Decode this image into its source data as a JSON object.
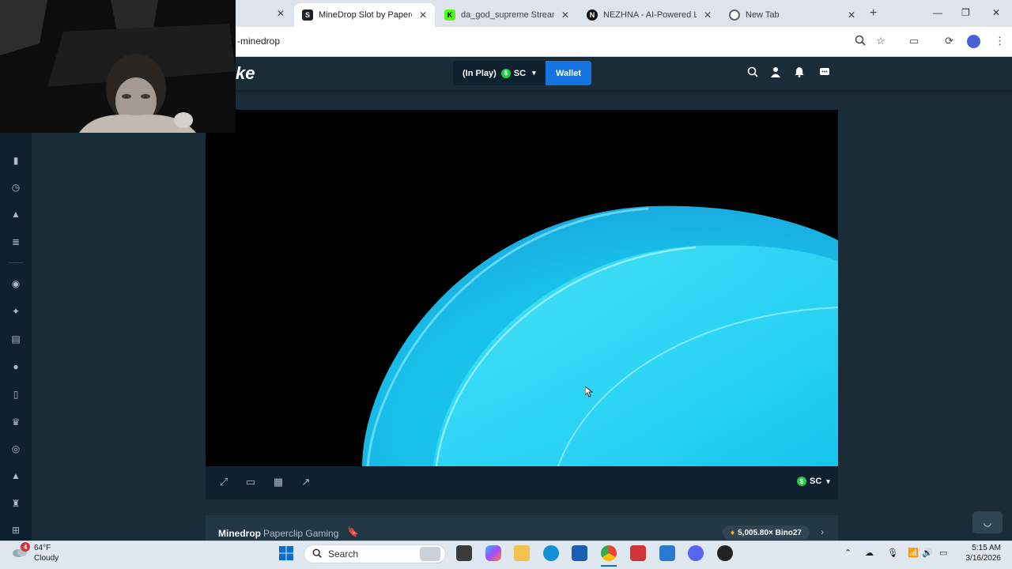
{
  "browser": {
    "tabs": [
      {
        "label": "MineDrop Slot by Paperclip",
        "favicon": "S",
        "favicon_color": "#202124",
        "active": true
      },
      {
        "label": "da_god_supreme Stream -",
        "favicon": "K",
        "favicon_color": "#53fc18",
        "active": false
      },
      {
        "label": "NEZHNA - AI-Powered Live",
        "favicon": "N",
        "favicon_color": "#111111",
        "active": false
      },
      {
        "label": "New Tab",
        "favicon": "chrome",
        "favicon_color": "#5f6368",
        "active": false
      }
    ],
    "url": "-minedrop"
  },
  "header": {
    "balance_label": "(In Play)",
    "currency": "SC",
    "wallet_label": "Wallet"
  },
  "game_bar": {
    "currency": "SC"
  },
  "game_info": {
    "title": "Minedrop",
    "provider": "Paperclip Gaming",
    "big_win": "5,005.80× Bino27"
  },
  "taskbar": {
    "weather_temp": "64°F",
    "weather_cond": "Cloudy",
    "weather_badge": "4",
    "search_label": "Search",
    "time": "5:15 AM",
    "date": "3/16/2026"
  },
  "colors": {
    "stake_bg": "#1a2c38",
    "stake_dark": "#0f212e",
    "wallet_blue": "#1475e1",
    "coin_green": "#1fce43",
    "bloom_cyan": "#19d5f2"
  }
}
